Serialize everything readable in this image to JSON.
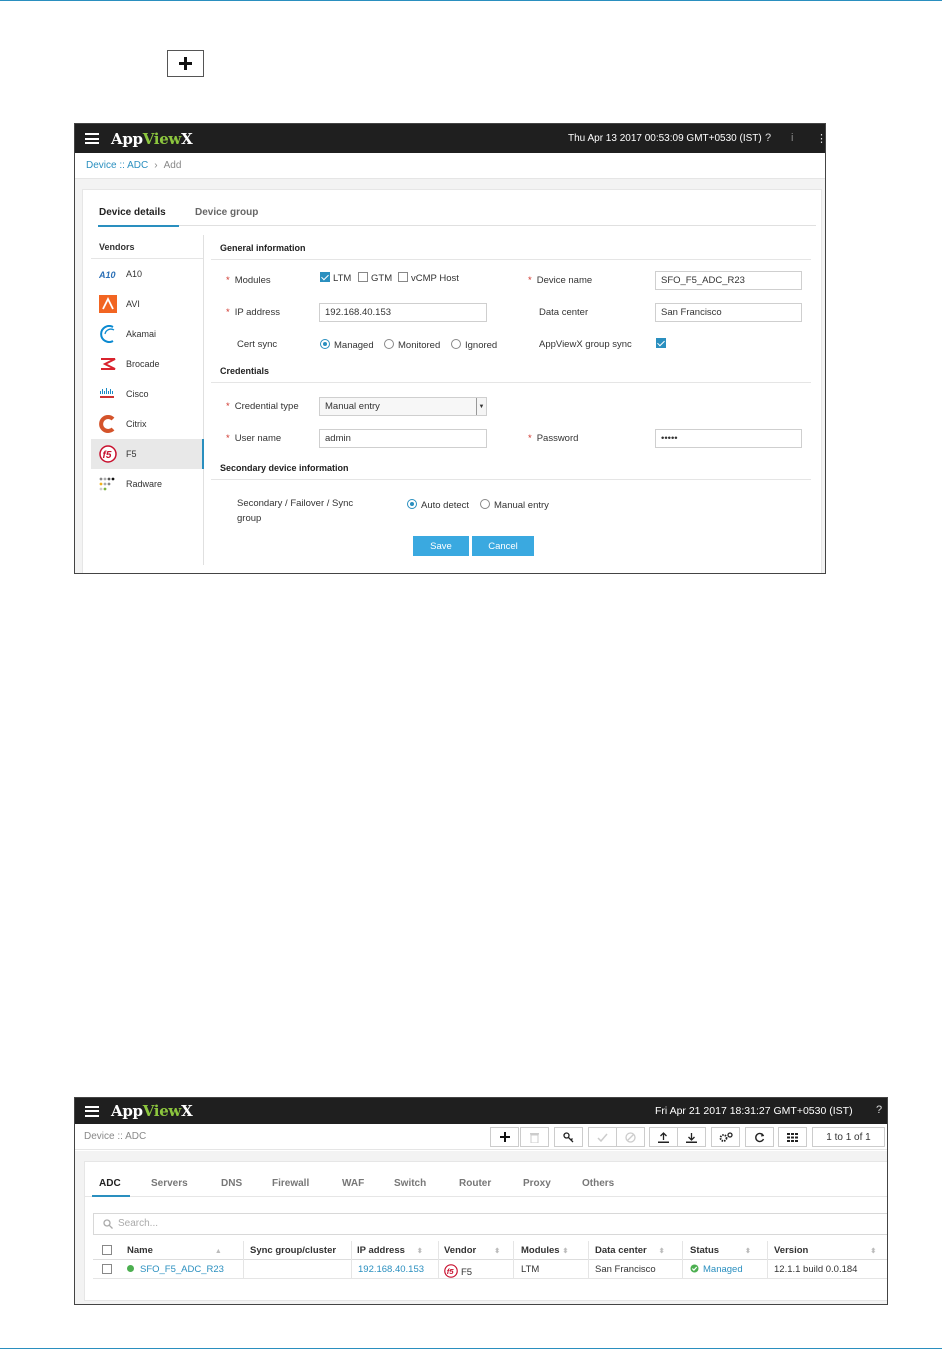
{
  "shot1": {
    "brand": {
      "app": "App",
      "view": "View",
      "x": "X"
    },
    "topbar": {
      "datetime": "Thu Apr 13 2017 00:53:09 GMT+0530 (IST)",
      "help": "?",
      "info": "i",
      "more": "⋮"
    },
    "breadcrumb": {
      "root": "Device :: ADC",
      "sep": "›",
      "current": "Add"
    },
    "tabs": [
      "Device details",
      "Device group"
    ],
    "vendors": {
      "title": "Vendors",
      "items": [
        "A10",
        "AVI",
        "Akamai",
        "Brocade",
        "Cisco",
        "Citrix",
        "F5",
        "Radware"
      ],
      "selected": "F5"
    },
    "sections": {
      "general": "General information",
      "credentials": "Credentials",
      "secondary": "Secondary device information"
    },
    "fields": {
      "modules_label": "Modules",
      "modules": [
        {
          "label": "LTM",
          "checked": true
        },
        {
          "label": "GTM",
          "checked": false
        },
        {
          "label": "vCMP Host",
          "checked": false
        }
      ],
      "device_name_label": "Device name",
      "device_name_value": "SFO_F5_ADC_R23",
      "ip_label": "IP address",
      "ip_value": "192.168.40.153",
      "dc_label": "Data center",
      "dc_value": "San Francisco",
      "cert_label": "Cert sync",
      "cert_options": [
        "Managed",
        "Monitored",
        "Ignored"
      ],
      "cert_selected": "Managed",
      "group_sync_label": "AppViewX group sync",
      "group_sync_checked": true,
      "cred_type_label": "Credential type",
      "cred_type_value": "Manual entry",
      "user_label": "User name",
      "user_value": "admin",
      "password_label": "Password",
      "password_value": "•••••",
      "secondary_label_1": "Secondary / Failover / Sync",
      "secondary_label_2": "group",
      "secondary_options": [
        "Auto detect",
        "Manual entry"
      ],
      "secondary_selected": "Auto detect"
    },
    "buttons": {
      "save": "Save",
      "cancel": "Cancel"
    }
  },
  "shot2": {
    "topbar": {
      "datetime": "Fri Apr 21 2017 18:31:27 GMT+0530 (IST)",
      "help": "?"
    },
    "breadcrumb": "Device :: ADC",
    "pager": "1 to 1 of 1",
    "tabs": [
      "ADC",
      "Servers",
      "DNS",
      "Firewall",
      "WAF",
      "Switch",
      "Router",
      "Proxy",
      "Others"
    ],
    "search_placeholder": "Search...",
    "columns": [
      "Name",
      "Sync group/cluster",
      "IP address",
      "Vendor",
      "Modules",
      "Data center",
      "Status",
      "Version"
    ],
    "row": {
      "name": "SFO_F5_ADC_R23",
      "sync": "",
      "ip": "192.168.40.153",
      "vendor": "F5",
      "modules": "LTM",
      "dc": "San Francisco",
      "status": "Managed",
      "version": "12.1.1 build 0.0.184"
    }
  },
  "colors": {
    "accent": "#2a8fbf",
    "button": "#3aa9e0",
    "topbar": "#1f1f1f",
    "logo_green": "#8cc63e",
    "required": "#d0342c",
    "status_ok": "#4caf50"
  }
}
